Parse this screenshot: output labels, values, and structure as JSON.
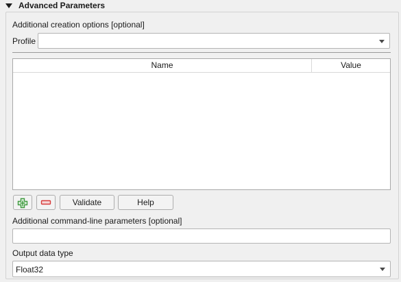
{
  "section": {
    "title": "Advanced Parameters"
  },
  "creation_options": {
    "label": "Additional creation options [optional]",
    "profile_label": "Profile",
    "profile_value": ""
  },
  "options_table": {
    "columns": [
      "Name",
      "Value"
    ],
    "rows": []
  },
  "table_buttons": {
    "add_icon": "add-row-icon",
    "remove_icon": "remove-row-icon",
    "validate_label": "Validate",
    "help_label": "Help"
  },
  "command_line": {
    "label": "Additional command-line parameters [optional]",
    "value": ""
  },
  "output_type": {
    "label": "Output data type",
    "value": "Float32"
  },
  "colors": {
    "add_icon": "#3f9a3f",
    "remove_icon": "#d63a3a"
  }
}
